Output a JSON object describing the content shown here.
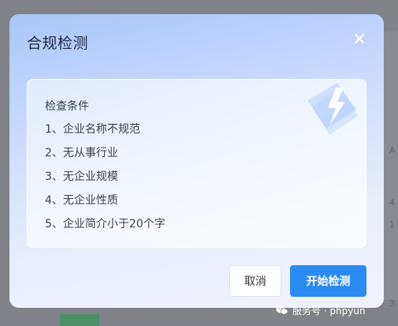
{
  "background": {
    "fragments": [
      "A",
      "4",
      "1",
      "3"
    ],
    "bottom_link": "",
    "bottom_gray": ""
  },
  "modal": {
    "title": "合规检测",
    "close_icon": "close-icon",
    "conditions": {
      "heading": "检查条件",
      "items": [
        "1、企业名称不规范",
        "2、无从事行业",
        "3、无企业规模",
        "4、无企业性质",
        "5、企业简介小于20个字"
      ],
      "decoration_icon": "lightning-icon"
    },
    "cancel_label": "取消",
    "start_label": "开始检测"
  },
  "watermark": {
    "text": "服务号 · phpyun",
    "icon": "wechat-icon"
  },
  "colors": {
    "primary": "#2b8bf3",
    "modal_gradient_top": "#a9c6fb",
    "modal_gradient_bottom": "#f1f3fb",
    "overlay": "#808287"
  }
}
